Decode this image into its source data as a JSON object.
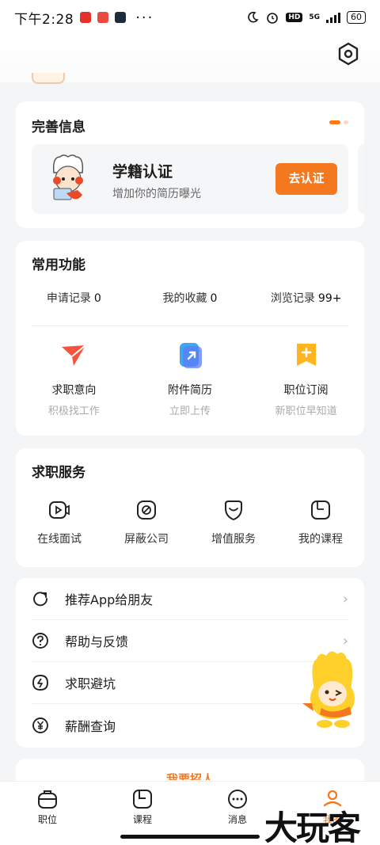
{
  "status_bar": {
    "time": "下午2:28",
    "dots": "···",
    "network": "5G",
    "battery": "60"
  },
  "info_card": {
    "title": "完善信息",
    "verify_title": "学籍认证",
    "verify_subtitle": "增加你的简历曝光",
    "verify_button": "去认证"
  },
  "common_card": {
    "title": "常用功能",
    "stats": [
      {
        "label": "申请记录",
        "value": "0"
      },
      {
        "label": "我的收藏",
        "value": "0"
      },
      {
        "label": "浏览记录",
        "value": "99+"
      }
    ],
    "features": [
      {
        "name": "求职意向",
        "desc": "积极找工作",
        "icon": "send-icon"
      },
      {
        "name": "附件简历",
        "desc": "立即上传",
        "icon": "upload-icon"
      },
      {
        "name": "职位订阅",
        "desc": "新职位早知道",
        "icon": "subscribe-icon"
      }
    ]
  },
  "services_card": {
    "title": "求职服务",
    "items": [
      {
        "label": "在线面试",
        "icon": "video-icon"
      },
      {
        "label": "屏蔽公司",
        "icon": "block-icon"
      },
      {
        "label": "增值服务",
        "icon": "heart-shield-icon"
      },
      {
        "label": "我的课程",
        "icon": "book-icon"
      }
    ]
  },
  "list": [
    {
      "label": "推荐App给朋友",
      "icon": "share-icon"
    },
    {
      "label": "帮助与反馈",
      "icon": "help-icon"
    },
    {
      "label": "求职避坑",
      "icon": "alert-icon"
    },
    {
      "label": "薪酬查询",
      "icon": "yen-icon"
    }
  ],
  "peek_card": {
    "text": "我要招人"
  },
  "tabbar": [
    {
      "label": "职位",
      "icon": "briefcase-icon"
    },
    {
      "label": "课程",
      "icon": "course-icon"
    },
    {
      "label": "消息",
      "icon": "message-icon"
    },
    {
      "label": "我的",
      "icon": "profile-icon"
    }
  ],
  "watermark": "大玩客",
  "colors": {
    "accent": "#f4781e",
    "background": "#f4f5f7"
  }
}
